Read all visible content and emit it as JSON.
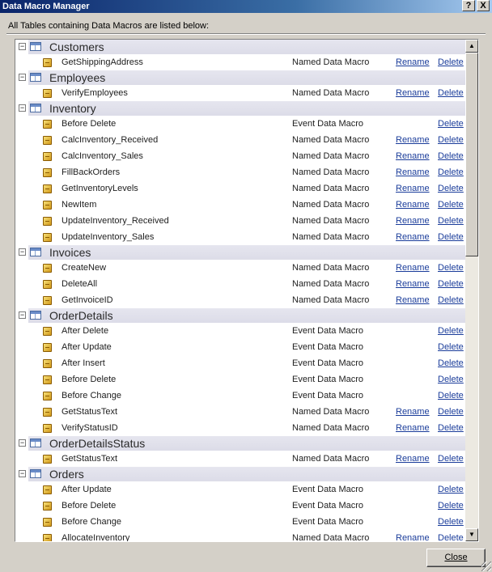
{
  "window": {
    "title": "Data Macro Manager",
    "help_label": "?",
    "close_label": "X"
  },
  "instruction": "All Tables containing Data Macros are listed below:",
  "labels": {
    "rename": "Rename",
    "delete": "Delete",
    "collapse": "−"
  },
  "groups": [
    {
      "name": "Customers",
      "items": [
        {
          "name": "GetShippingAddress",
          "type": "Named Data Macro",
          "rename": true
        }
      ]
    },
    {
      "name": "Employees",
      "items": [
        {
          "name": "VerifyEmployees",
          "type": "Named Data Macro",
          "rename": true
        }
      ]
    },
    {
      "name": "Inventory",
      "items": [
        {
          "name": "Before Delete",
          "type": "Event Data Macro",
          "rename": false
        },
        {
          "name": "CalcInventory_Received",
          "type": "Named Data Macro",
          "rename": true
        },
        {
          "name": "CalcInventory_Sales",
          "type": "Named Data Macro",
          "rename": true
        },
        {
          "name": "FillBackOrders",
          "type": "Named Data Macro",
          "rename": true
        },
        {
          "name": "GetInventoryLevels",
          "type": "Named Data Macro",
          "rename": true
        },
        {
          "name": "NewItem",
          "type": "Named Data Macro",
          "rename": true
        },
        {
          "name": "UpdateInventory_Received",
          "type": "Named Data Macro",
          "rename": true
        },
        {
          "name": "UpdateInventory_Sales",
          "type": "Named Data Macro",
          "rename": true
        }
      ]
    },
    {
      "name": "Invoices",
      "items": [
        {
          "name": "CreateNew",
          "type": "Named Data Macro",
          "rename": true
        },
        {
          "name": "DeleteAll",
          "type": "Named Data Macro",
          "rename": true
        },
        {
          "name": "GetInvoiceID",
          "type": "Named Data Macro",
          "rename": true
        }
      ]
    },
    {
      "name": "OrderDetails",
      "items": [
        {
          "name": "After Delete",
          "type": "Event Data Macro",
          "rename": false
        },
        {
          "name": "After Update",
          "type": "Event Data Macro",
          "rename": false
        },
        {
          "name": "After Insert",
          "type": "Event Data Macro",
          "rename": false
        },
        {
          "name": "Before Delete",
          "type": "Event Data Macro",
          "rename": false
        },
        {
          "name": "Before Change",
          "type": "Event Data Macro",
          "rename": false
        },
        {
          "name": "GetStatusText",
          "type": "Named Data Macro",
          "rename": true
        },
        {
          "name": "VerifyStatusID",
          "type": "Named Data Macro",
          "rename": true
        }
      ]
    },
    {
      "name": "OrderDetailsStatus",
      "items": [
        {
          "name": "GetStatusText",
          "type": "Named Data Macro",
          "rename": true
        }
      ]
    },
    {
      "name": "Orders",
      "items": [
        {
          "name": "After Update",
          "type": "Event Data Macro",
          "rename": false
        },
        {
          "name": "Before Delete",
          "type": "Event Data Macro",
          "rename": false
        },
        {
          "name": "Before Change",
          "type": "Event Data Macro",
          "rename": false
        },
        {
          "name": "AllocateInventory",
          "type": "Named Data Macro",
          "rename": true
        }
      ]
    }
  ],
  "scrollbar": {
    "up_label": "▲",
    "down_label": "▼"
  },
  "footer": {
    "close_label": "Close"
  }
}
